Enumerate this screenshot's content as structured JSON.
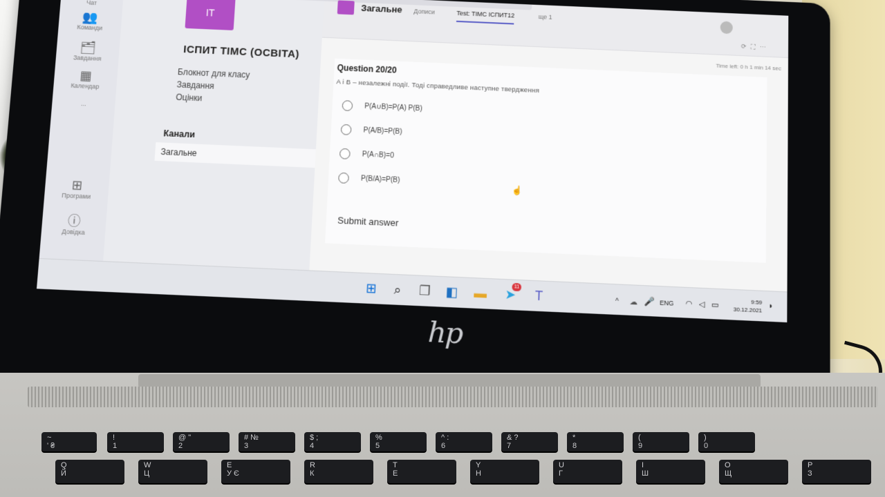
{
  "teams": {
    "rail": {
      "items": [
        {
          "label": "Чат",
          "icon": "chat-icon"
        },
        {
          "label": "Команди",
          "icon": "teams-icon"
        },
        {
          "label": "Завдання",
          "icon": "assignments-icon"
        },
        {
          "label": "Календар",
          "icon": "calendar-icon"
        },
        {
          "label": "...",
          "icon": "more-icon"
        },
        {
          "label": "Програми",
          "icon": "apps-icon"
        },
        {
          "label": "Довідка",
          "icon": "help-icon"
        }
      ]
    },
    "team": {
      "avatar": "ІТ",
      "name": "ІСПИТ ТІМС (ОСВІТА)",
      "more": "···",
      "links": [
        "Блокнот для класу",
        "Завдання",
        "Оцінки"
      ],
      "channels_header": "Канали",
      "channels": [
        "Загальне"
      ]
    },
    "header": {
      "channel": "Загальне",
      "tabs": [
        "Дописи",
        "Test: ТІМС ІСПИТ12",
        "ще 1"
      ],
      "active_tab": "Test: ТІМС ІСПИТ12"
    },
    "time_left": "Time left: 0 h 1 min 14 sec",
    "quiz": {
      "question_title": "Question 20/20",
      "question_text": "A і B – незалежні події. Тоді справедливе наступне твердження",
      "options": [
        "P(A∪B)=P(A) P(B)",
        "P(A/B)=P(B)",
        "P(A∩B)=0",
        "P(B/A)=P(B)"
      ],
      "submit_label": "Submit answer"
    }
  },
  "taskbar": {
    "apps": [
      "start-icon",
      "search-icon",
      "task-view-icon",
      "widgets-icon",
      "file-explorer-icon",
      "telegram-icon",
      "teams-icon"
    ],
    "telegram_badge": "11",
    "lang": "ENG",
    "time": "9:59",
    "date": "30.12.2021"
  },
  "device": {
    "brand_logo": "hp"
  },
  "keyboard": {
    "row1": [
      {
        "top": "~",
        "bot": "' ₴"
      },
      {
        "top": "!",
        "bot": "1"
      },
      {
        "top": "@ \"",
        "bot": "2"
      },
      {
        "top": "# №",
        "bot": "3"
      },
      {
        "top": "$ ;",
        "bot": "4"
      },
      {
        "top": "%",
        "bot": "5"
      },
      {
        "top": "^ :",
        "bot": "6"
      },
      {
        "top": "& ?",
        "bot": "7"
      },
      {
        "top": "* ",
        "bot": "8"
      },
      {
        "top": "( ",
        "bot": "9"
      },
      {
        "top": ") ",
        "bot": "0"
      }
    ],
    "row2": [
      {
        "top": "Q",
        "bot": "Й"
      },
      {
        "top": "W",
        "bot": "Ц"
      },
      {
        "top": "E",
        "bot": "У  Є"
      },
      {
        "top": "R",
        "bot": "К"
      },
      {
        "top": "T",
        "bot": "Е"
      },
      {
        "top": "Y",
        "bot": "Н"
      },
      {
        "top": "U",
        "bot": "Г"
      },
      {
        "top": "I",
        "bot": "Ш"
      },
      {
        "top": "O",
        "bot": "Щ"
      },
      {
        "top": "P",
        "bot": "З"
      }
    ]
  }
}
